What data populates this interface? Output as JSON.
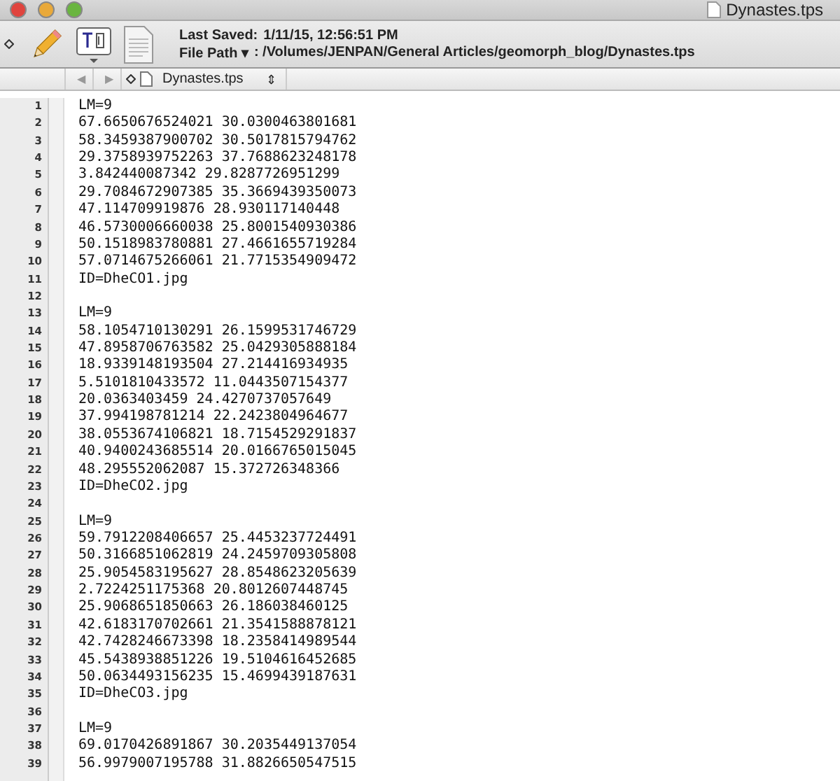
{
  "window": {
    "title": "Dynastes.tps"
  },
  "info": {
    "last_saved_label": "Last Saved:",
    "last_saved": "1/11/15, 12:56:51 PM",
    "file_path_label": "File Path",
    "file_path_caret": "▾",
    "file_path": ": /Volumes/JENPAN/General Articles/geomorph_blog/Dynastes.tps"
  },
  "navigation": {
    "back": "◀",
    "forward": "▶",
    "document": "Dynastes.tps",
    "stepper": "⇕"
  },
  "lines": [
    {
      "number": "1",
      "text": "LM=9"
    },
    {
      "number": "2",
      "text": "67.6650676524021 30.0300463801681"
    },
    {
      "number": "3",
      "text": "58.3459387900702 30.5017815794762"
    },
    {
      "number": "4",
      "text": "29.3758939752263 37.7688623248178"
    },
    {
      "number": "5",
      "text": "3.842440087342 29.8287726951299"
    },
    {
      "number": "6",
      "text": "29.7084672907385 35.3669439350073"
    },
    {
      "number": "7",
      "text": "47.114709919876 28.930117140448"
    },
    {
      "number": "8",
      "text": "46.5730006660038 25.8001540930386"
    },
    {
      "number": "9",
      "text": "50.1518983780881 27.4661655719284"
    },
    {
      "number": "10",
      "text": "57.0714675266061 21.7715354909472"
    },
    {
      "number": "11",
      "text": "ID=DheCO1.jpg"
    },
    {
      "number": "12"
    },
    {
      "number": "13",
      "text": "LM=9"
    },
    {
      "number": "14",
      "text": "58.1054710130291 26.1599531746729"
    },
    {
      "number": "15",
      "text": "47.8958706763582 25.0429305888184"
    },
    {
      "number": "16",
      "text": "18.9339148193504 27.214416934935"
    },
    {
      "number": "17",
      "text": "5.5101810433572 11.0443507154377"
    },
    {
      "number": "18",
      "text": "20.0363403459 24.4270737057649"
    },
    {
      "number": "19",
      "text": "37.994198781214 22.2423804964677"
    },
    {
      "number": "20",
      "text": "38.0553674106821 18.7154529291837"
    },
    {
      "number": "21",
      "text": "40.9400243685514 20.0166765015045"
    },
    {
      "number": "22",
      "text": "48.295552062087 15.372726348366"
    },
    {
      "number": "23",
      "text": "ID=DheCO2.jpg"
    },
    {
      "number": "24"
    },
    {
      "number": "25",
      "text": "LM=9"
    },
    {
      "number": "26",
      "text": "59.7912208406657 25.4453237724491"
    },
    {
      "number": "27",
      "text": "50.3166851062819 24.2459709305808"
    },
    {
      "number": "28",
      "text": "25.9054583195627 28.8548623205639"
    },
    {
      "number": "29",
      "text": "2.7224251175368 20.8012607448745"
    },
    {
      "number": "30",
      "text": "25.9068651850663 26.186038460125"
    },
    {
      "number": "31",
      "text": "42.6183170702661 21.3541588878121"
    },
    {
      "number": "32",
      "text": "42.7428246673398 18.2358414989544"
    },
    {
      "number": "33",
      "text": "45.5438938851226 19.5104616452685"
    },
    {
      "number": "34",
      "text": "50.0634493156235 15.4699439187631"
    },
    {
      "number": "35",
      "text": "ID=DheCO3.jpg"
    },
    {
      "number": "36"
    },
    {
      "number": "37",
      "text": "LM=9"
    },
    {
      "number": "38",
      "text": "69.0170426891867 30.2035449137054"
    },
    {
      "number": "39",
      "text": "56.9979007195788 31.8826650547515"
    }
  ]
}
